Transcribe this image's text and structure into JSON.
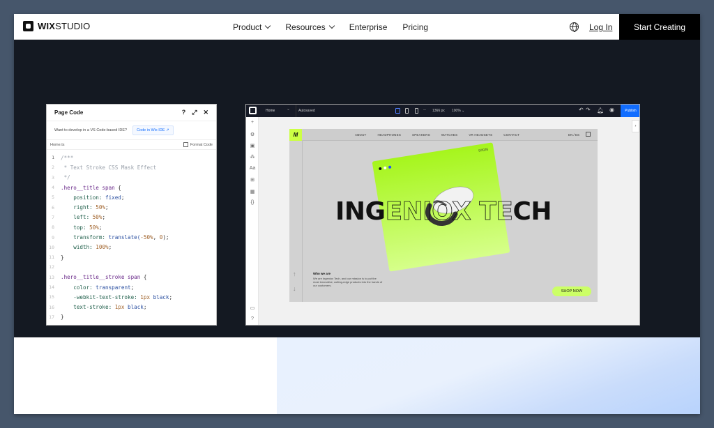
{
  "topnav": {
    "brand_bold": "WIX",
    "brand_light": "STUDIO",
    "items": [
      {
        "label": "Product",
        "has_dropdown": true
      },
      {
        "label": "Resources",
        "has_dropdown": true
      },
      {
        "label": "Enterprise",
        "has_dropdown": false
      },
      {
        "label": "Pricing",
        "has_dropdown": false
      }
    ],
    "language_icon": "globe-icon",
    "login_label": "Log In",
    "cta_label": "Start Creating"
  },
  "code_panel": {
    "title": "Page Code",
    "header_icons": [
      "help-icon",
      "expand-icon",
      "close-icon"
    ],
    "ide_prompt": "Want to develop in a VS Code-based IDE?",
    "ide_button": "Code in Wix IDE",
    "file_name": "Home.ts",
    "format_label": "Format Code",
    "lines": [
      {
        "n": "1",
        "tokens": [
          {
            "t": "/***",
            "c": "cm"
          }
        ]
      },
      {
        "n": "2",
        "tokens": [
          {
            "t": " * Text Stroke CSS Mask Effect",
            "c": "cm"
          }
        ]
      },
      {
        "n": "3",
        "tokens": [
          {
            "t": " */",
            "c": "cm"
          }
        ]
      },
      {
        "n": "4",
        "tokens": [
          {
            "t": ".hero__title span ",
            "c": "sel"
          },
          {
            "t": "{",
            "c": "pun"
          }
        ]
      },
      {
        "n": "5",
        "tokens": [
          {
            "t": "    position: ",
            "c": "prop"
          },
          {
            "t": "fixed",
            "c": "val"
          },
          {
            "t": ";",
            "c": "pun"
          }
        ]
      },
      {
        "n": "6",
        "tokens": [
          {
            "t": "    right: ",
            "c": "prop"
          },
          {
            "t": "50%",
            "c": "num"
          },
          {
            "t": ";",
            "c": "pun"
          }
        ]
      },
      {
        "n": "7",
        "tokens": [
          {
            "t": "    left: ",
            "c": "prop"
          },
          {
            "t": "50%",
            "c": "num"
          },
          {
            "t": ";",
            "c": "pun"
          }
        ]
      },
      {
        "n": "8",
        "tokens": [
          {
            "t": "    top: ",
            "c": "prop"
          },
          {
            "t": "50%",
            "c": "num"
          },
          {
            "t": ";",
            "c": "pun"
          }
        ]
      },
      {
        "n": "9",
        "tokens": [
          {
            "t": "    transform: ",
            "c": "prop"
          },
          {
            "t": "translate(",
            "c": "val"
          },
          {
            "t": "-50%",
            "c": "num"
          },
          {
            "t": ", ",
            "c": "pun"
          },
          {
            "t": "0",
            "c": "num"
          },
          {
            "t": ");",
            "c": "pun"
          }
        ]
      },
      {
        "n": "10",
        "tokens": [
          {
            "t": "    width: ",
            "c": "prop"
          },
          {
            "t": "100%",
            "c": "num"
          },
          {
            "t": ";",
            "c": "pun"
          }
        ]
      },
      {
        "n": "11",
        "tokens": [
          {
            "t": "}",
            "c": "pun"
          }
        ]
      },
      {
        "n": "12",
        "tokens": []
      },
      {
        "n": "13",
        "tokens": [
          {
            "t": ".hero__title__stroke span ",
            "c": "sel"
          },
          {
            "t": "{",
            "c": "pun"
          }
        ]
      },
      {
        "n": "14",
        "tokens": [
          {
            "t": "    color: ",
            "c": "prop"
          },
          {
            "t": "transparent",
            "c": "val"
          },
          {
            "t": ";",
            "c": "pun"
          }
        ]
      },
      {
        "n": "15",
        "tokens": [
          {
            "t": "    -webkit-text-stroke: ",
            "c": "prop"
          },
          {
            "t": "1px",
            "c": "num"
          },
          {
            "t": " black",
            "c": "val"
          },
          {
            "t": ";",
            "c": "pun"
          }
        ]
      },
      {
        "n": "16",
        "tokens": [
          {
            "t": "    text-stroke: ",
            "c": "prop"
          },
          {
            "t": "1px",
            "c": "num"
          },
          {
            "t": " black",
            "c": "val"
          },
          {
            "t": ";",
            "c": "pun"
          }
        ]
      },
      {
        "n": "17",
        "tokens": [
          {
            "t": "}",
            "c": "pun"
          }
        ]
      }
    ]
  },
  "editor": {
    "page_select": "Home",
    "save_status": "Autosaved",
    "width_readout": "1366 px",
    "zoom_readout": "100%",
    "publish_label": "Publish",
    "left_tools": [
      "add-icon",
      "layers-icon",
      "pages-icon",
      "design-icon",
      "text-icon",
      "apps-icon",
      "cms-icon",
      "code-icon"
    ],
    "bottom_tools": [
      "chat-icon",
      "help-icon"
    ]
  },
  "site": {
    "logo": "M",
    "nav_links": [
      "ABOUT",
      "HEADPHONES",
      "SPEAKERS",
      "WATCHES",
      "VR HEADSETS",
      "CONTACT"
    ],
    "lang": "EN / ES",
    "date": "5/2026",
    "hero_solid_start": "ING",
    "hero_stroke": "ENIOX TE",
    "hero_solid_end": "CH",
    "who_title": "Who we are",
    "who_body": "We are Ingeniox Tech, and our mission is to put the most innovative, cutting-edge products into the hands of our customers.",
    "shop_label": "SHOP NOW",
    "accent": "#ccff44"
  },
  "colors": {
    "publish": "#116dff",
    "dark_bg": "#141922",
    "outer_bg": "#46566b"
  }
}
